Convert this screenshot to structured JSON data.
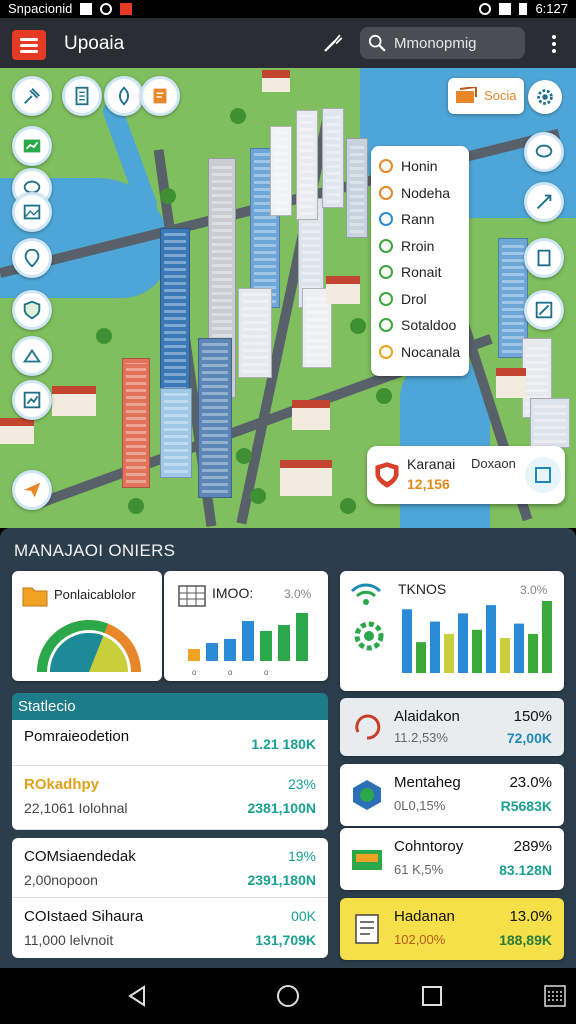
{
  "status_bar": {
    "carrier": "Snpacionid",
    "time": "6:127"
  },
  "app_bar": {
    "title": "Upoaia",
    "search_text": "Mmonopmig"
  },
  "map": {
    "social_label": "Socia",
    "legend": [
      {
        "label": "Honin",
        "color": "#e8862a"
      },
      {
        "label": "Nodeha",
        "color": "#e8862a"
      },
      {
        "label": "Rann",
        "color": "#2a8bd6"
      },
      {
        "label": "Rroin",
        "color": "#3aa83a"
      },
      {
        "label": "Ronait",
        "color": "#3aa83a"
      },
      {
        "label": "Drol",
        "color": "#3aa83a"
      },
      {
        "label": "Sotaldoo",
        "color": "#3aa83a"
      },
      {
        "label": "Nocanala",
        "color": "#e8a21c"
      }
    ],
    "info_card": {
      "title": "Karanai",
      "subtitle": "Doxaon",
      "value": "12,156"
    }
  },
  "dashboard": {
    "title": "MANAJAOI ONIERS",
    "card_gauge": {
      "title": "Ponlaicablolor",
      "level": 0.62
    },
    "card_bars_small": {
      "title": "IMOO:",
      "pct": "3.0%",
      "values": [
        12,
        18,
        22,
        40,
        30,
        36,
        48
      ]
    },
    "card_bars_large": {
      "title": "TKNOS",
      "pct": "3.0%",
      "values": [
        {
          "v": 62,
          "c": "#2a8bd6"
        },
        {
          "v": 30,
          "c": "#3aa83a"
        },
        {
          "v": 50,
          "c": "#2a8bd6"
        },
        {
          "v": 38,
          "c": "#c9cf3a"
        },
        {
          "v": 58,
          "c": "#2a8bd6"
        },
        {
          "v": 42,
          "c": "#3aa83a"
        },
        {
          "v": 66,
          "c": "#2a8bd6"
        },
        {
          "v": 34,
          "c": "#c9cf3a"
        },
        {
          "v": 48,
          "c": "#2a8bd6"
        },
        {
          "v": 38,
          "c": "#3aa83a"
        },
        {
          "v": 70,
          "c": "#3aa83a"
        }
      ]
    },
    "statistics": {
      "header": "Statlecio",
      "rows": [
        {
          "name": "Pomraieodetion",
          "sub": "",
          "pct": "",
          "val": "1.21 180K"
        },
        {
          "name": "ROkadhpy",
          "sub": "22,1061 Iolohnal",
          "pct": "23%",
          "val": "2381,100N"
        },
        {
          "name": "COMsiaendedak",
          "sub": "2,00nopoon",
          "pct": "19%",
          "val": "2391,180N"
        },
        {
          "name": "COIstaed Sihaura",
          "sub": "11,000 lelvnoit",
          "pct": "00K",
          "val": "131,709K"
        }
      ]
    },
    "right_cards": [
      {
        "name": "Alaidakon",
        "sub": "11.2,53%",
        "pct": "150%",
        "val": "72,00K",
        "bg": "#e9ecef"
      },
      {
        "name": "Mentaheg",
        "sub": "0L0,15%",
        "pct": "23.0%",
        "val": "R5683K",
        "bg": "#ffffff"
      },
      {
        "name": "Cohntoroy",
        "sub": "61 K,5%",
        "pct": "289%",
        "val": "83.128N",
        "bg": "#ffffff"
      },
      {
        "name": "Hadanan",
        "sub": "102,00%",
        "pct": "13.0%",
        "val": "188,89K",
        "bg": "#f5e04a"
      }
    ]
  }
}
